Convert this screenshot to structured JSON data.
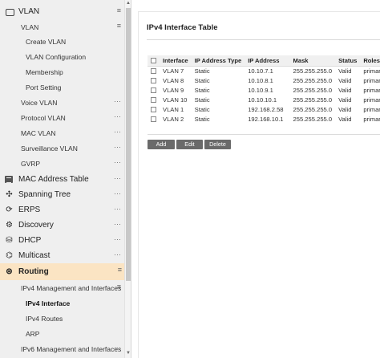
{
  "sidebar": {
    "items": [
      {
        "label": "VLAN",
        "level": "top",
        "icon": "vlan-stack-icon",
        "more": "≡"
      },
      {
        "label": "VLAN",
        "level": "sub",
        "more": "≡"
      },
      {
        "label": "Create VLAN",
        "level": "sub2"
      },
      {
        "label": "VLAN Configuration",
        "level": "sub2"
      },
      {
        "label": "Membership",
        "level": "sub2"
      },
      {
        "label": "Port Setting",
        "level": "sub2"
      },
      {
        "label": "Voice VLAN",
        "level": "sub",
        "more": "···"
      },
      {
        "label": "Protocol VLAN",
        "level": "sub",
        "more": "···"
      },
      {
        "label": "MAC VLAN",
        "level": "sub",
        "more": "···"
      },
      {
        "label": "Surveillance VLAN",
        "level": "sub",
        "more": "···"
      },
      {
        "label": "GVRP",
        "level": "sub",
        "more": "···"
      },
      {
        "label": "MAC Address Table",
        "level": "top",
        "icon": "table-icon",
        "more": "···"
      },
      {
        "label": "Spanning Tree",
        "level": "top",
        "icon": "spanning-tree-icon",
        "more": "···"
      },
      {
        "label": "ERPS",
        "level": "top",
        "icon": "erps-ring-icon",
        "more": "···"
      },
      {
        "label": "Discovery",
        "level": "top",
        "icon": "discovery-icon",
        "more": "···"
      },
      {
        "label": "DHCP",
        "level": "top",
        "icon": "database-icon",
        "more": "···"
      },
      {
        "label": "Multicast",
        "level": "top",
        "icon": "multicast-icon",
        "more": "···"
      },
      {
        "label": "Routing",
        "level": "top",
        "icon": "routing-icon",
        "more": "≡",
        "active": true
      },
      {
        "label": "IPv4 Management and Interfaces",
        "level": "sub",
        "more": "≡"
      },
      {
        "label": "IPv4 Interface",
        "level": "sub2",
        "selected": true
      },
      {
        "label": "IPv4 Routes",
        "level": "sub2"
      },
      {
        "label": "ARP",
        "level": "sub2"
      },
      {
        "label": "IPv6 Management and Interfaces",
        "level": "sub",
        "more": "···"
      }
    ]
  },
  "main": {
    "title": "IPv4 Interface Table",
    "table": {
      "headers": [
        "Interface",
        "IP Address Type",
        "IP Address",
        "Mask",
        "Status",
        "Roles"
      ],
      "rows": [
        [
          "VLAN 7",
          "Static",
          "10.10.7.1",
          "255.255.255.0",
          "Valid",
          "primary"
        ],
        [
          "VLAN 8",
          "Static",
          "10.10.8.1",
          "255.255.255.0",
          "Valid",
          "primary"
        ],
        [
          "VLAN 9",
          "Static",
          "10.10.9.1",
          "255.255.255.0",
          "Valid",
          "primary"
        ],
        [
          "VLAN 10",
          "Static",
          "10.10.10.1",
          "255.255.255.0",
          "Valid",
          "primary"
        ],
        [
          "VLAN 1",
          "Static",
          "192.168.2.58",
          "255.255.255.0",
          "Valid",
          "primary"
        ],
        [
          "VLAN 2",
          "Static",
          "192.168.10.1",
          "255.255.255.0",
          "Valid",
          "primary"
        ]
      ]
    },
    "buttons": {
      "add": "Add",
      "edit": "Edit",
      "delete": "Delete"
    }
  },
  "colors": {
    "active_item_bg": "#fbe4c3",
    "button_bg": "#6a6a6a",
    "sidebar_bg": "#efefef"
  }
}
